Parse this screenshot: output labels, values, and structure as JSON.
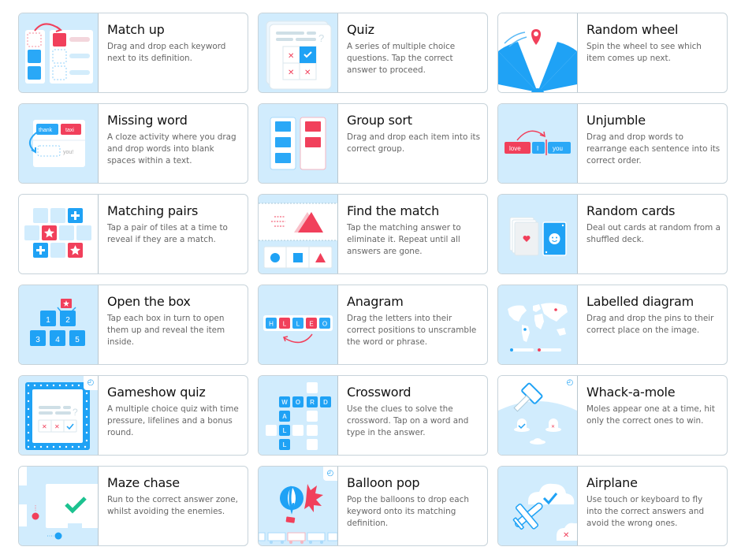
{
  "templates": [
    {
      "id": "match-up",
      "title": "Match up",
      "description": "Drag and drop each keyword next to its definition."
    },
    {
      "id": "quiz",
      "title": "Quiz",
      "description": "A series of multiple choice questions. Tap the correct answer to proceed."
    },
    {
      "id": "random-wheel",
      "title": "Random wheel",
      "description": "Spin the wheel to see which item comes up next."
    },
    {
      "id": "missing-word",
      "title": "Missing word",
      "description": "A cloze activity where you drag and drop words into blank spaces within a text.",
      "thumb_words": [
        "thank",
        "taxi",
        "you!"
      ]
    },
    {
      "id": "group-sort",
      "title": "Group sort",
      "description": "Drag and drop each item into its correct group."
    },
    {
      "id": "unjumble",
      "title": "Unjumble",
      "description": "Drag and drop words to rearrange each sentence into its correct order.",
      "thumb_words": [
        "love",
        "I",
        "you"
      ]
    },
    {
      "id": "matching-pairs",
      "title": "Matching pairs",
      "description": "Tap a pair of tiles at a time to reveal if they are a match."
    },
    {
      "id": "find-the-match",
      "title": "Find the match",
      "description": "Tap the matching answer to eliminate it. Repeat until all answers are gone."
    },
    {
      "id": "random-cards",
      "title": "Random cards",
      "description": "Deal out cards at random from a shuffled deck."
    },
    {
      "id": "open-the-box",
      "title": "Open the box",
      "description": "Tap each box in turn to open them up and reveal the item inside.",
      "thumb_numbers": [
        "1",
        "2",
        "3",
        "4",
        "5"
      ]
    },
    {
      "id": "anagram",
      "title": "Anagram",
      "description": "Drag the letters into their correct positions to unscramble the word or phrase.",
      "thumb_letters": [
        "H",
        "L",
        "L",
        "E",
        "O"
      ]
    },
    {
      "id": "labelled-diagram",
      "title": "Labelled diagram",
      "description": "Drag and drop the pins to their correct place on the image."
    },
    {
      "id": "gameshow-quiz",
      "title": "Gameshow quiz",
      "description": "A multiple choice quiz with time pressure, lifelines and a bonus round.",
      "timed": true
    },
    {
      "id": "crossword",
      "title": "Crossword",
      "description": "Use the clues to solve the crossword. Tap on a word and type in the answer.",
      "thumb_letters": [
        "W",
        "O",
        "R",
        "D",
        "A",
        "L",
        "L"
      ]
    },
    {
      "id": "whack-a-mole",
      "title": "Whack-a-mole",
      "description": "Moles appear one at a time, hit only the correct ones to win.",
      "timed": true
    },
    {
      "id": "maze-chase",
      "title": "Maze chase",
      "description": "Run to the correct answer zone, whilst avoiding the enemies."
    },
    {
      "id": "balloon-pop",
      "title": "Balloon pop",
      "description": "Pop the balloons to drop each keyword onto its matching definition.",
      "timed": true
    },
    {
      "id": "airplane",
      "title": "Airplane",
      "description": "Use touch or keyboard to fly into the correct answers and avoid the wrong ones."
    }
  ],
  "colors": {
    "blue": "#1fa2f5",
    "red": "#f1405b",
    "thumb_bg": "#d1ecfd",
    "green": "#1cc290"
  }
}
